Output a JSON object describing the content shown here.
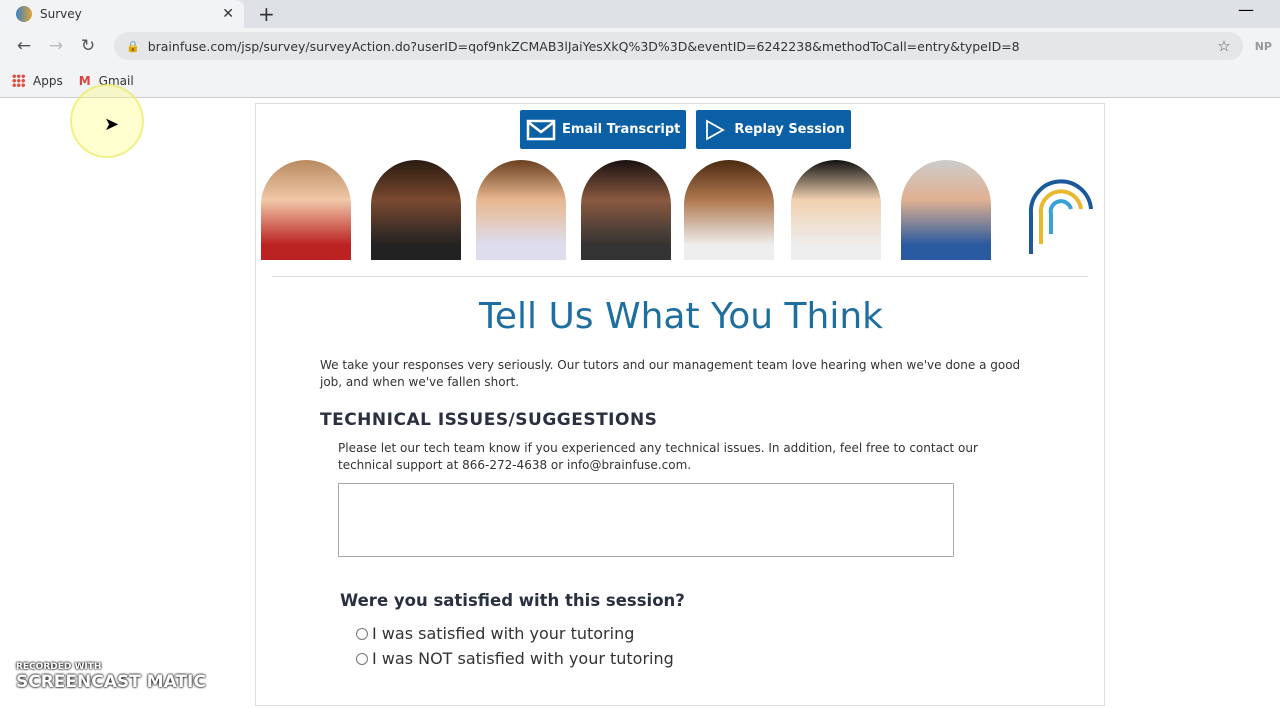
{
  "browser": {
    "tab_title": "Survey",
    "url": "brainfuse.com/jsp/survey/surveyAction.do?userID=qof9nkZCMAB3lJaiYesXkQ%3D%3D&eventID=6242238&methodToCall=entry&typeID=8",
    "profile": "NP",
    "bookmarks": [
      {
        "label": "Apps"
      },
      {
        "label": "Gmail"
      }
    ]
  },
  "page": {
    "buttons": {
      "email": "Email Transcript",
      "replay": "Replay Session"
    },
    "title": "Tell Us What You Think",
    "intro": "We take your responses very seriously. Our tutors and our management team love hearing when we've done a good job, and when we've fallen short.",
    "section_heading": "TECHNICAL ISSUES/SUGGESTIONS",
    "section_help": "Please let our tech team know if you experienced any technical issues. In addition, feel free to contact our technical support at 866-272-4638 or info@brainfuse.com.",
    "suggestions_value": "",
    "question": "Were you satisfied with this session?",
    "options": [
      "I was satisfied with your tutoring",
      "I was NOT satisfied with your tutoring"
    ]
  },
  "watermark": {
    "top": "RECORDED WITH",
    "bottom": "SCREENCAST MATIC"
  },
  "colors": {
    "accent": "#0b5fa5",
    "title": "#1e6ea0"
  }
}
